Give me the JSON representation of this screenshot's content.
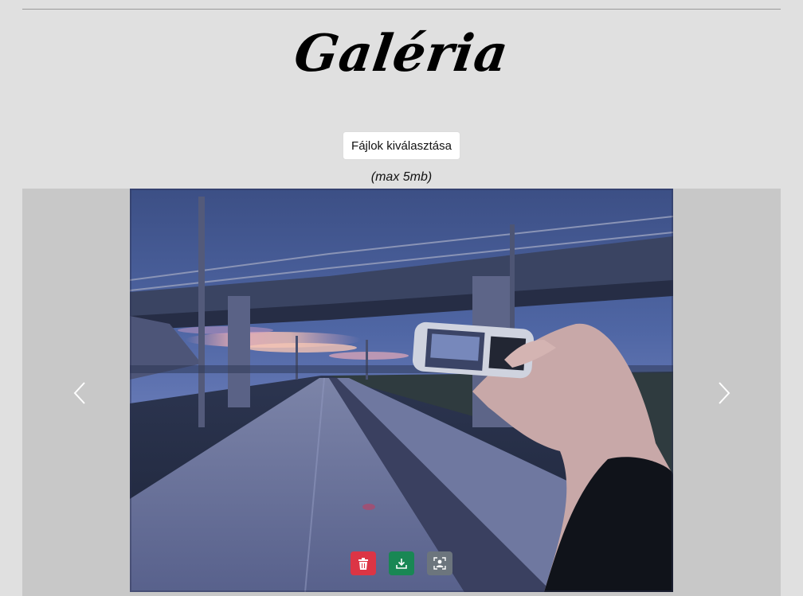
{
  "page": {
    "title": "Galéria"
  },
  "upload": {
    "button_label": "Fájlok kiválasztása",
    "size_note": "(max 5mb)"
  },
  "carousel": {
    "prev_icon": "chevron-left-icon",
    "next_icon": "chevron-right-icon",
    "actions": [
      {
        "name": "delete",
        "icon": "trash-icon",
        "color": "#dc3545"
      },
      {
        "name": "download",
        "icon": "download-icon",
        "color": "#198754"
      },
      {
        "name": "profile",
        "icon": "person-frame-icon",
        "color": "#6c757d"
      }
    ]
  }
}
